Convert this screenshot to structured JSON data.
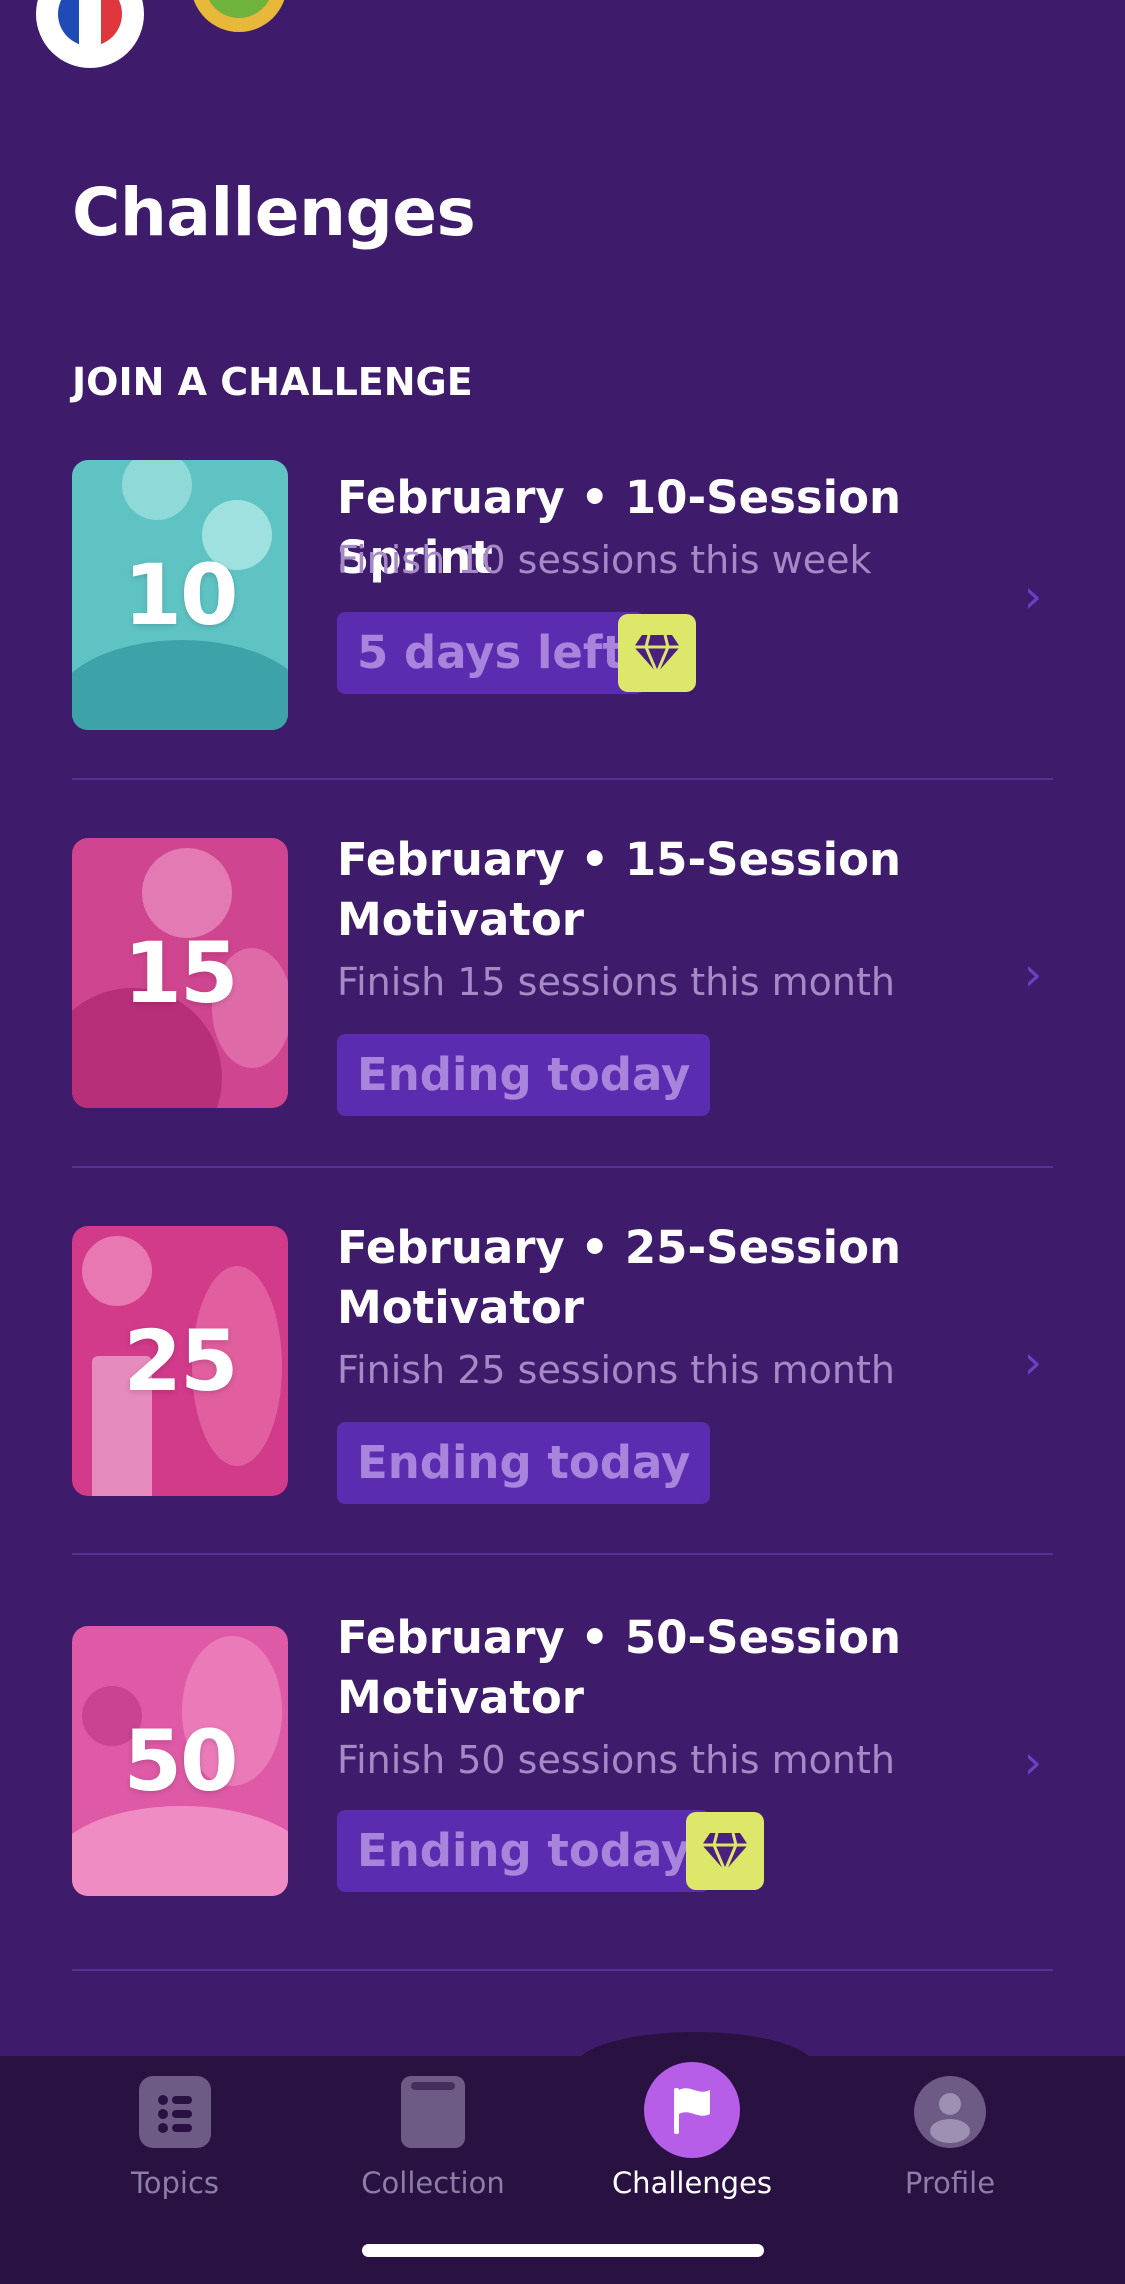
{
  "page_title": "Challenges",
  "section_heading": "JOIN A CHALLENGE",
  "challenges": [
    {
      "badge_number": "10",
      "title": "February • 10-Session Sprint",
      "subtitle": "Finish 10 sessions this week",
      "status": "5 days left",
      "has_gem": true,
      "thumb_color": "#5fc3c4"
    },
    {
      "badge_number": "15",
      "title": "February • 15-Session Motivator",
      "subtitle": "Finish 15 sessions this month",
      "status": "Ending today",
      "has_gem": false,
      "thumb_color": "#d0458f"
    },
    {
      "badge_number": "25",
      "title": "February • 25-Session Motivator",
      "subtitle": "Finish 25 sessions this month",
      "status": "Ending today",
      "has_gem": false,
      "thumb_color": "#d23a8a"
    },
    {
      "badge_number": "50",
      "title": "February • 50-Session Motivator",
      "subtitle": "Finish 50 sessions this month",
      "status": "Ending today",
      "has_gem": true,
      "thumb_color": "#de5aa6"
    }
  ],
  "nav": {
    "topics": "Topics",
    "collection": "Collection",
    "challenges": "Challenges",
    "profile": "Profile"
  },
  "colors": {
    "background": "#3f1b6b",
    "pill": "#5b2bb0",
    "gem": "#dde76a",
    "active_nav": "#b65ee8"
  }
}
